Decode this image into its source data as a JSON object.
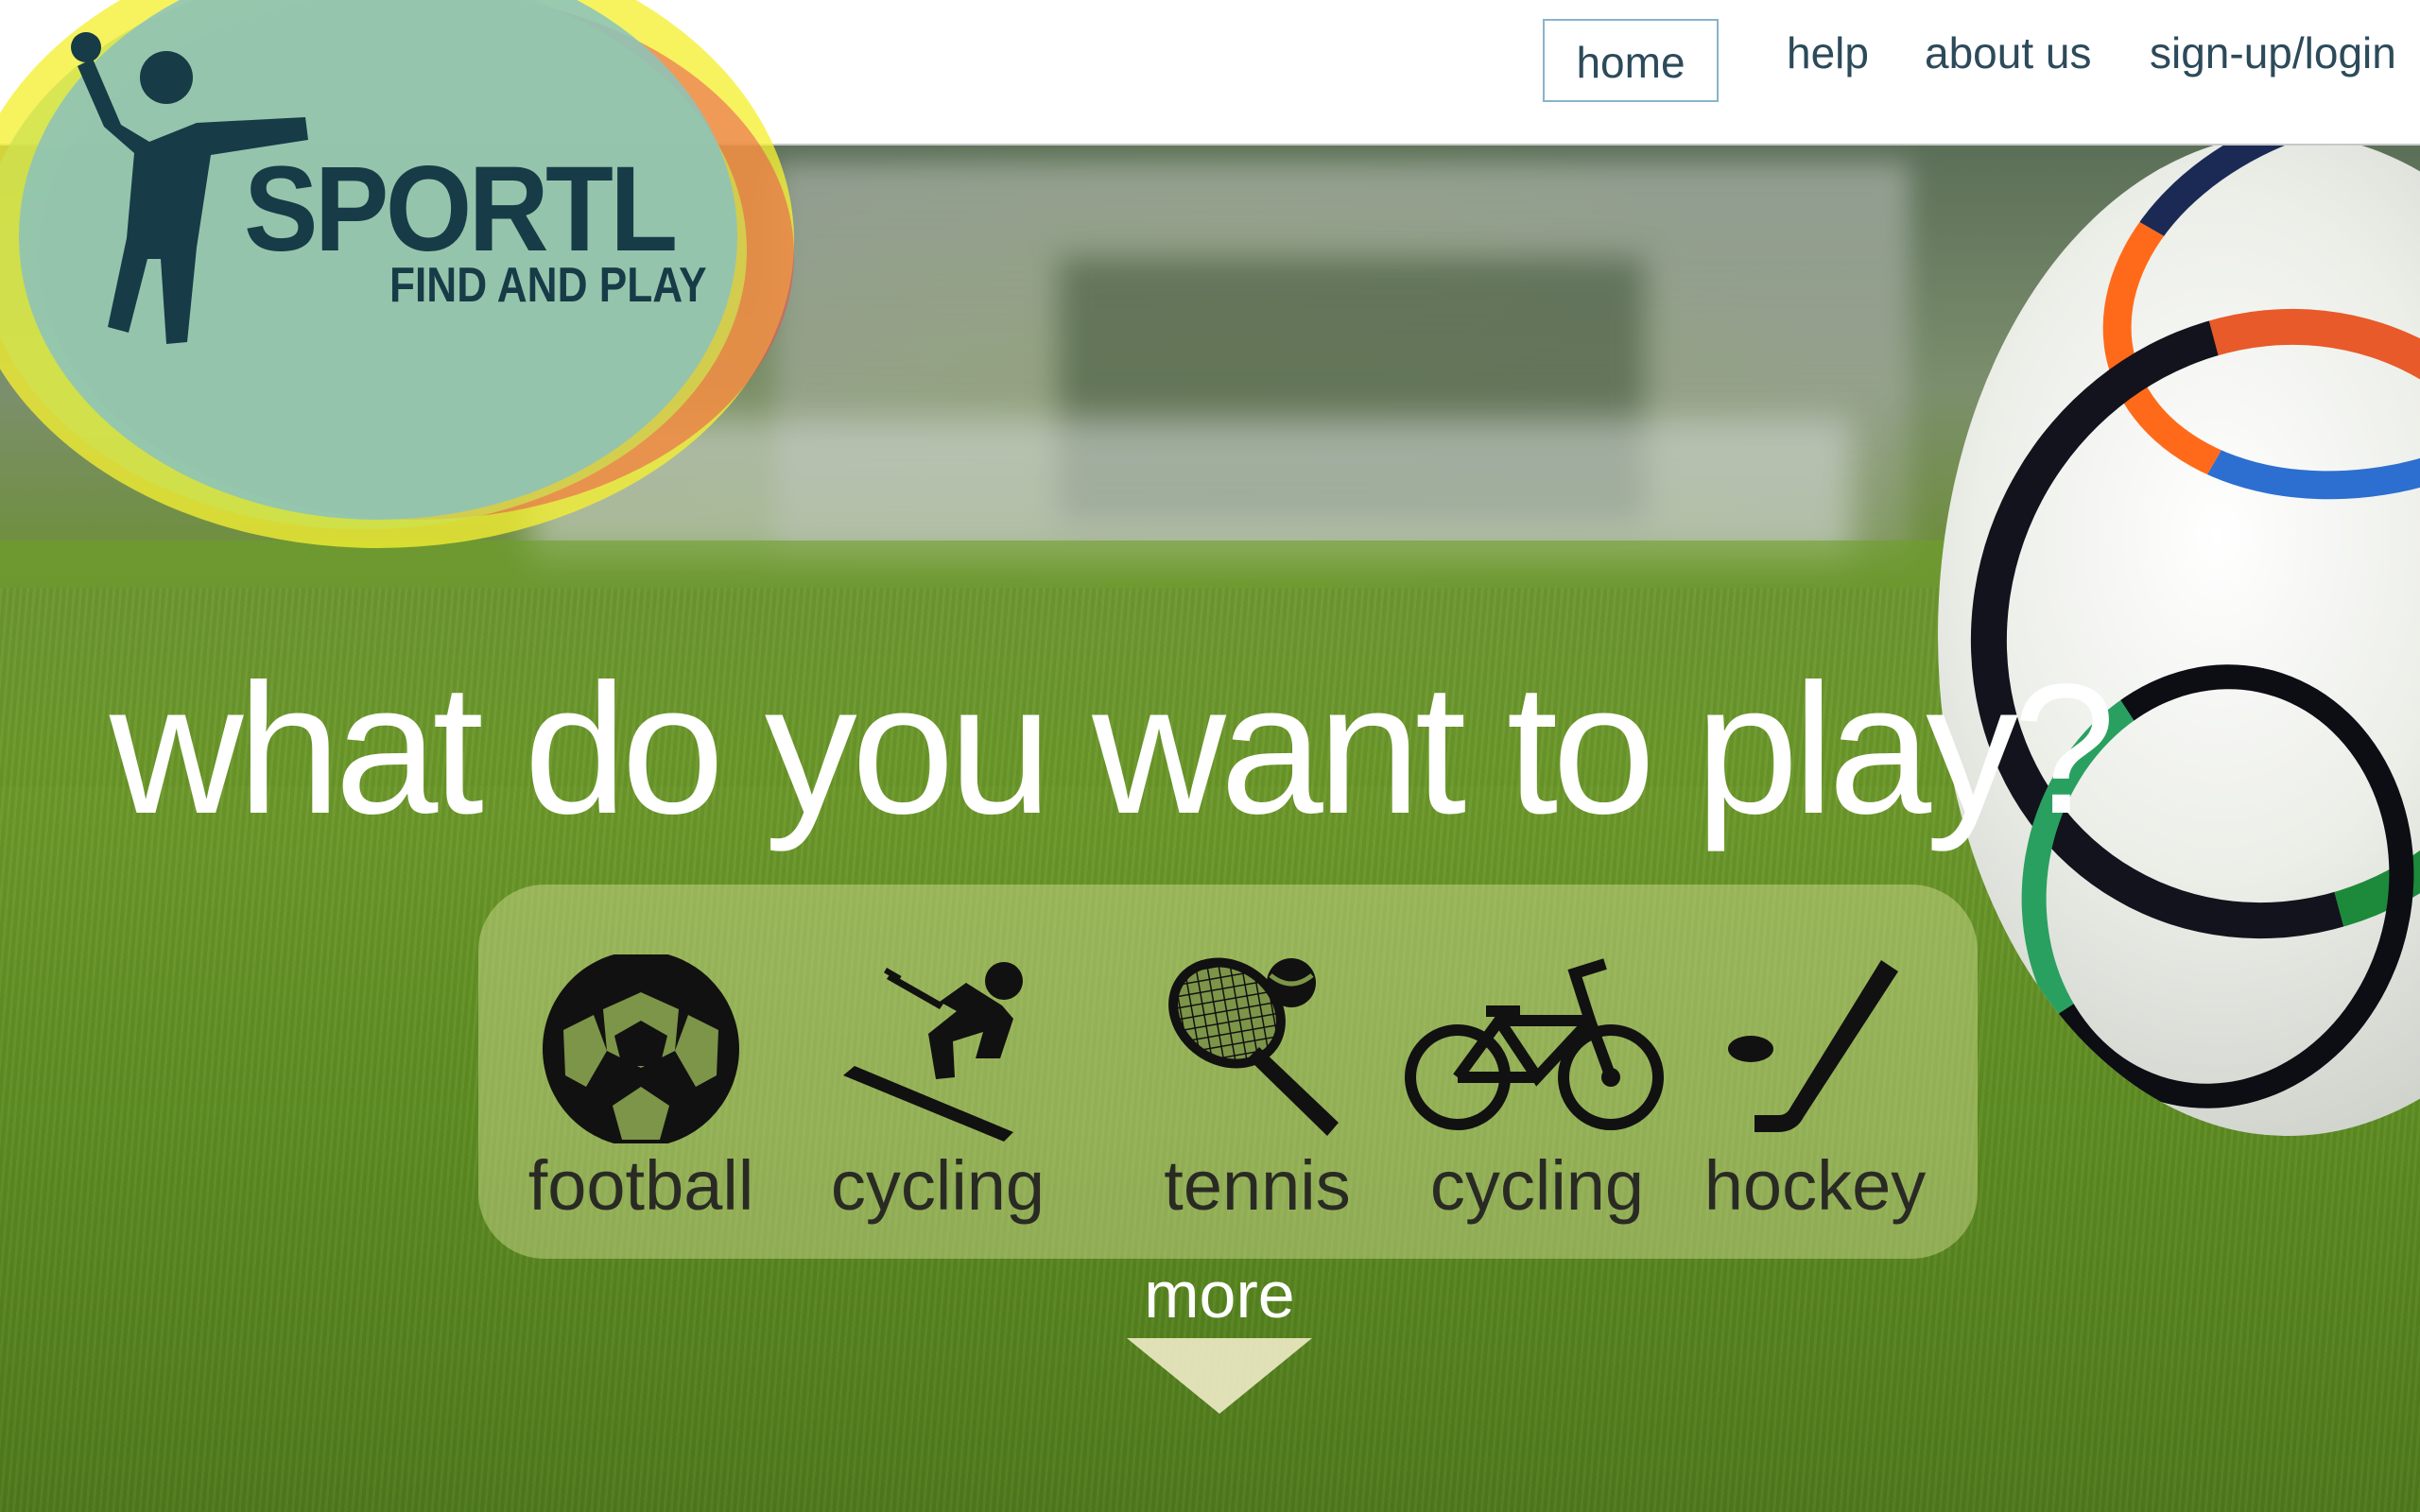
{
  "nav": {
    "items": [
      {
        "label": "home",
        "active": true
      },
      {
        "label": "help"
      },
      {
        "label": "about us"
      },
      {
        "label": "sign-up/login"
      }
    ]
  },
  "logo": {
    "brand": "SPORTL",
    "tagline": "FIND AND PLAY"
  },
  "hero": {
    "headline": "what do you want to play?"
  },
  "sports": [
    {
      "label": "football",
      "icon": "football-icon"
    },
    {
      "label": "cycling",
      "icon": "skiing-icon"
    },
    {
      "label": "tennis",
      "icon": "tennis-icon"
    },
    {
      "label": "cycling",
      "icon": "bicycle-icon"
    },
    {
      "label": "hockey",
      "icon": "hockey-icon"
    }
  ],
  "more": {
    "label": "more",
    "icon": "down-arrow-icon"
  },
  "colors": {
    "brand_dark": "#173b47",
    "nav_text": "#2c4a5a",
    "active_border": "#88b4cc",
    "logo_teal": "#8cc3b9",
    "logo_yellow": "#f5f032"
  }
}
